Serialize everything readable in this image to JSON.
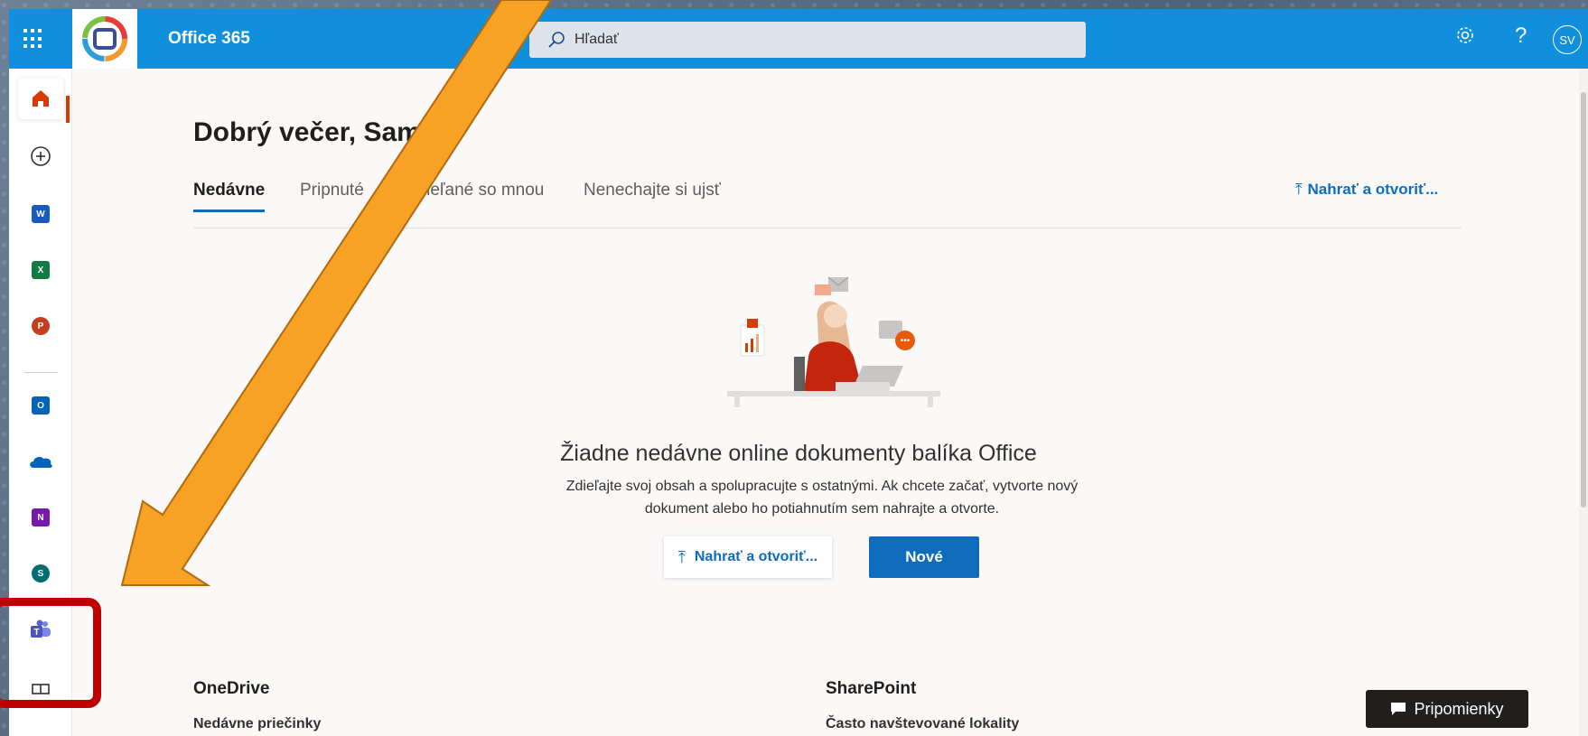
{
  "header": {
    "app_name": "Office 365",
    "search_placeholder": "Hľadať",
    "avatar_initials": "SV"
  },
  "greeting": "Dobrý večer, Samuel",
  "tabs": [
    {
      "label": "Nedávne",
      "active": true
    },
    {
      "label": "Pripnuté",
      "active": false
    },
    {
      "label": "Zdieľané so mnou",
      "active": false
    },
    {
      "label": "Nenechajte si ujsť",
      "active": false
    }
  ],
  "upload_link": "Nahrať a otvoriť...",
  "empty_state": {
    "title": "Žiadne nedávne online dokumenty balíka Office",
    "description_line1": "Zdieľajte svoj obsah a spolupracujte s ostatnými. Ak chcete začať, vytvorte nový",
    "description_line2": "dokument alebo ho potiahnutím sem nahrajte a otvorte.",
    "upload_button": "Nahrať a otvoriť...",
    "new_button": "Nové"
  },
  "sections": {
    "onedrive": {
      "title": "OneDrive",
      "subtitle": "Nedávne priečinky"
    },
    "sharepoint": {
      "title": "SharePoint",
      "subtitle": "Často navštevované lokality"
    }
  },
  "feedback_button": "Pripomienky",
  "rail_apps": [
    {
      "name": "home-icon"
    },
    {
      "name": "create-icon"
    },
    {
      "name": "word-icon",
      "letter": "W",
      "color": "#185abd"
    },
    {
      "name": "excel-icon",
      "letter": "X",
      "color": "#107c41"
    },
    {
      "name": "powerpoint-icon",
      "letter": "P",
      "color": "#c43e1c"
    },
    {
      "name": "outlook-icon",
      "letter": "O",
      "color": "#0364b8"
    },
    {
      "name": "onedrive-icon",
      "color": "#0364b8"
    },
    {
      "name": "onenote-icon",
      "letter": "N",
      "color": "#7719aa"
    },
    {
      "name": "sharepoint-icon",
      "letter": "S",
      "color": "#036c70"
    },
    {
      "name": "teams-icon",
      "color": "#5b5fc7"
    },
    {
      "name": "all-apps-icon"
    }
  ],
  "colors": {
    "brand_blue": "#0f8fdc",
    "accent_blue": "#0f6cbd",
    "highlight_red": "#c00000",
    "arrow_orange": "#f7a125"
  }
}
